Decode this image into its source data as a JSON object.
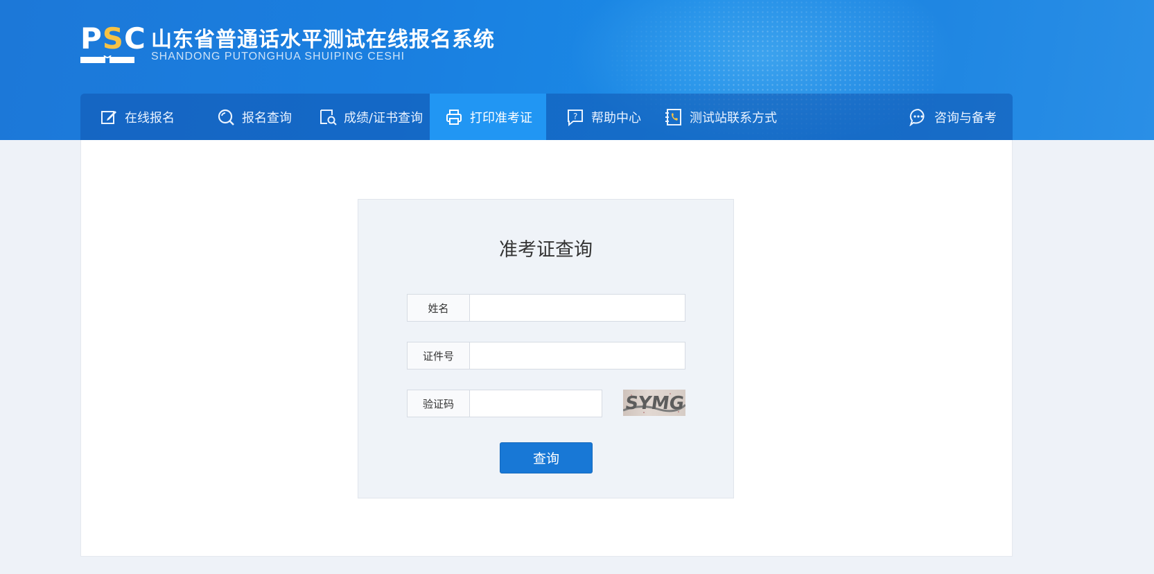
{
  "header": {
    "logo_prefix": "P",
    "logo_accent": "S",
    "logo_suffix": "C",
    "title": "山东省普通话水平测试在线报名系统",
    "subtitle": "SHANDONG PUTONGHUA SHUIPING CESHI"
  },
  "nav": {
    "items": [
      {
        "label": "在线报名",
        "icon": "edit-icon"
      },
      {
        "label": "报名查询",
        "icon": "search-icon"
      },
      {
        "label": "成绩/证书查询",
        "icon": "certificate-search-icon"
      },
      {
        "label": "打印准考证",
        "icon": "printer-icon",
        "active": true
      },
      {
        "label": "帮助中心",
        "icon": "help-icon"
      },
      {
        "label": "测试站联系方式",
        "icon": "contact-book-icon"
      },
      {
        "label": "咨询与备考",
        "icon": "chat-bubble-icon"
      }
    ]
  },
  "form": {
    "title": "准考证查询",
    "name_label": "姓名",
    "name_value": "",
    "id_label": "证件号",
    "id_value": "",
    "captcha_label": "验证码",
    "captcha_value": "",
    "captcha_text": "SYMG",
    "submit_label": "查询"
  },
  "colors": {
    "banner": "#1a7fe0",
    "nav_active": "#2196f3",
    "button": "#1878d6",
    "logo_accent": "#f6c244"
  }
}
